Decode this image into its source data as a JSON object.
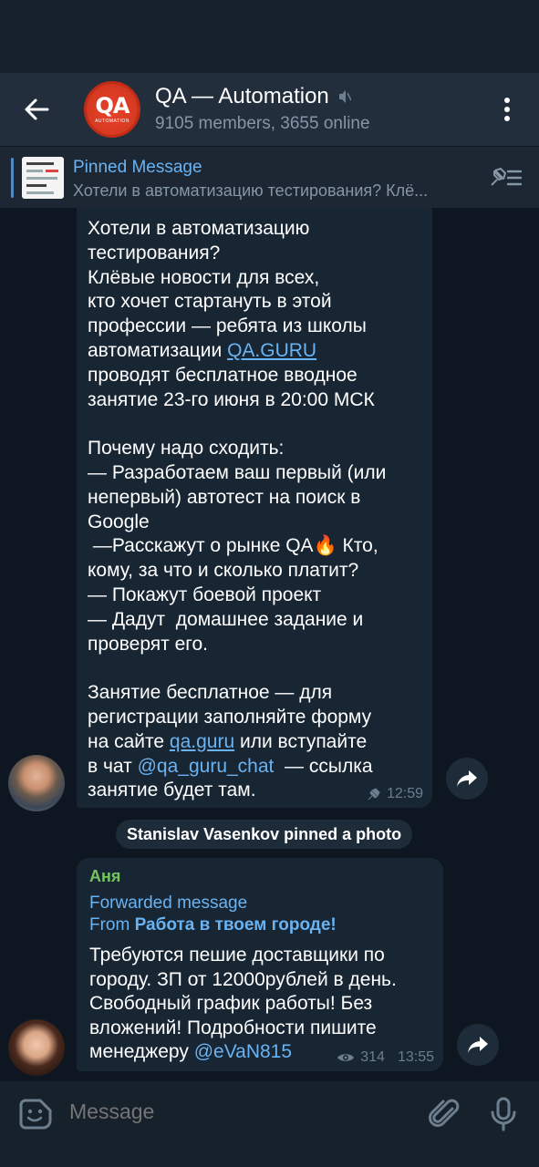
{
  "header": {
    "title": "QA — Automation",
    "subtitle": "9105 members, 3655 online",
    "avatar_text": "QA",
    "avatar_caption": "AUTOMATION"
  },
  "pinned": {
    "title": "Pinned Message",
    "preview": "Хотели в автоматизацию тестирования? Клё..."
  },
  "messages": [
    {
      "text_a": "Хотели в автоматизацию\nтестирования?\nКлёвые новости для всех,\nкто хочет стартануть в этой\nпрофессии — ребята из школы\nавтоматизации ",
      "link_a": "QA.GURU",
      "text_b": "\nпроводят бесплатное вводное\nзанятие 23-го июня в 20:00 МСК\n\nПочему надо сходить:\n— Разработаем ваш первый (или\nнепервый) автотест на поиск в\nGoogle\n —Расскажут о рынке QA🔥 Кто,\nкому, за что и сколько платит?\n— Покажут боевой проект\n— Дадут  домашнее задание и\nпроверят его.\n\nЗанятие бесплатное — для\nрегистрации заполняйте форму\nна сайте ",
      "link_b": "qa.guru",
      "text_c": " или вступайте\nв чат ",
      "link_c": "@qa_guru_chat",
      "text_d": "  — ссылка\nзанятие будет там.",
      "time": "12:59"
    },
    {
      "sender": "Аня",
      "forwarded_label": "Forwarded message",
      "from_prefix": "From ",
      "from_name": "Работа в твоем городе!",
      "text_a": "Требуются пешие доставщики по\nгороду. ЗП от 12000рублей в день.\nСвободный график работы! Без\nвложений! Подробности пишите\nменеджеру ",
      "mention": "@eVaN815",
      "views": "314",
      "time": "13:55"
    }
  ],
  "service": {
    "text": "Stanislav Vasenkov pinned a photo"
  },
  "composer": {
    "placeholder": "Message"
  },
  "colors": {
    "header_bg": "#232e3c",
    "chat_bg": "#0e1621",
    "bubble_bg": "#182533",
    "accent": "#6ab3f3",
    "sender_green": "#74c561"
  }
}
